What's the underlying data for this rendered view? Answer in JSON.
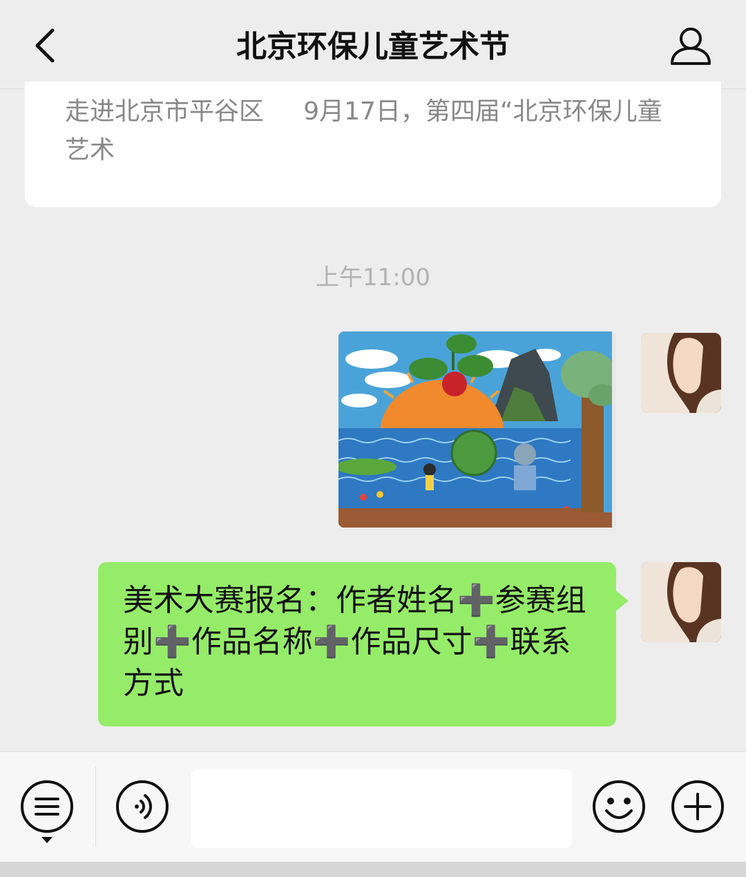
{
  "navbar": {
    "title": "北京环保儿童艺术节",
    "back_icon": "chevron-left-icon",
    "profile_icon": "person-icon"
  },
  "article": {
    "summary": "走进北京市平谷区     9月17日，第四届“北京环保儿童艺术"
  },
  "conversation": {
    "timestamp": "上午11:00",
    "image_message": {
      "content": "children's environmental drawing"
    },
    "text_message": {
      "text": "美术大赛报名：作者姓名➕参赛组别➕作品名称➕作品尺寸➕联系方式"
    }
  },
  "input_bar": {
    "menu_icon": "menu-list-icon",
    "voice_icon": "voice-icon",
    "emoji_icon": "emoji-icon",
    "plus_icon": "plus-circle-icon",
    "input_value": "",
    "input_placeholder": ""
  },
  "colors": {
    "background": "#ededed",
    "bubble": "#95ec69",
    "timestamp": "#b2b2b2",
    "article_text": "#888888"
  }
}
